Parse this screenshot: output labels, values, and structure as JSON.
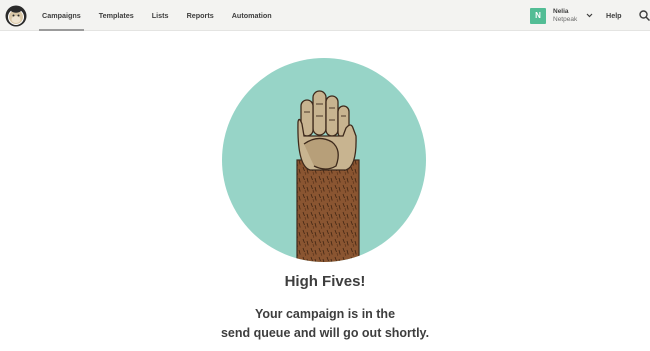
{
  "nav": {
    "items": [
      {
        "label": "Campaigns",
        "active": true
      },
      {
        "label": "Templates",
        "active": false
      },
      {
        "label": "Lists",
        "active": false
      },
      {
        "label": "Reports",
        "active": false
      },
      {
        "label": "Automation",
        "active": false
      }
    ]
  },
  "account": {
    "initial": "N",
    "name": "Nelia",
    "organization": "Netpeak",
    "avatar_color": "#52bd95"
  },
  "header": {
    "help_label": "Help",
    "background": "#f3f3f1"
  },
  "icons": {
    "logo": "chimp-logo-icon",
    "menu": "chevron-down-icon",
    "search": "search-icon",
    "illustration": "high-five-hand-icon"
  },
  "confirmation": {
    "title": "High Fives!",
    "message_line1": "Your campaign is in the",
    "message_line2": "send queue and will go out shortly.",
    "circle_color": "#97d4c7",
    "arm_color": "#8a5531",
    "hand_color": "#c8b490"
  }
}
